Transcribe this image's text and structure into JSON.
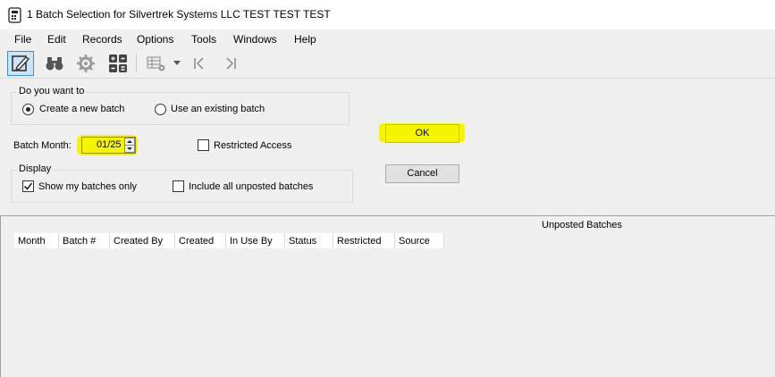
{
  "window": {
    "title": "1 Batch Selection for Silvertrek Systems LLC TEST TEST TEST"
  },
  "menu": [
    "File",
    "Edit",
    "Records",
    "Options",
    "Tools",
    "Windows",
    "Help"
  ],
  "toolbar": {
    "icons": [
      "edit-icon",
      "binoculars-icon",
      "gear-icon",
      "calculator-icon",
      "grid-settings-icon",
      "dropdown-arrow-icon",
      "first-record-icon",
      "last-record-icon"
    ]
  },
  "form": {
    "mode_group_label": "Do you want to",
    "create_new_label": "Create a new batch",
    "use_existing_label": "Use an existing batch",
    "selected_mode": "create_new",
    "batch_month_label": "Batch Month:",
    "batch_month_value": "01/25",
    "restricted_access_label": "Restricted Access",
    "restricted_access_checked": false,
    "display_group_label": "Display",
    "show_my_batches_label": "Show my batches only",
    "show_my_batches_checked": true,
    "include_unposted_label": "Include all unposted batches",
    "include_unposted_checked": false,
    "ok_label": "OK",
    "cancel_label": "Cancel",
    "highlight_color": "#f5f500"
  },
  "grid": {
    "caption": "Unposted Batches",
    "columns": [
      "Month",
      "Batch #",
      "Created By",
      "Created",
      "In Use By",
      "Status",
      "Restricted",
      "Source"
    ],
    "rows": []
  }
}
